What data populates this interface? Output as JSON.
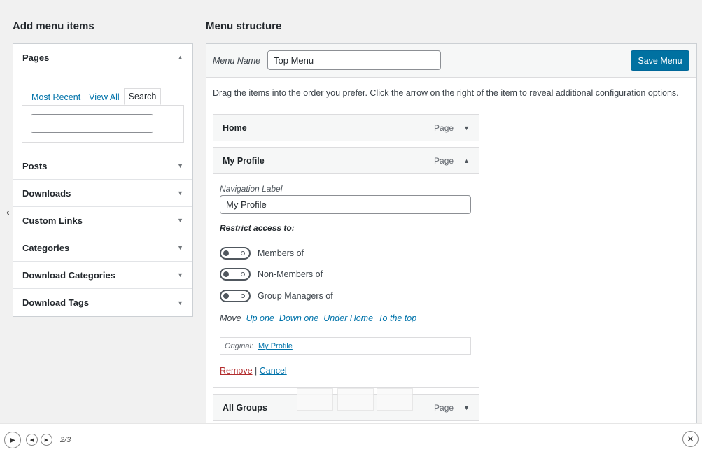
{
  "left_heading": "Add menu items",
  "right_heading": "Menu structure",
  "pages_panel": {
    "title": "Pages",
    "tabs": [
      "Most Recent",
      "View All",
      "Search"
    ],
    "active_tab": "Search",
    "search_value": ""
  },
  "accordion": [
    {
      "label": "Posts"
    },
    {
      "label": "Downloads"
    },
    {
      "label": "Custom Links"
    },
    {
      "label": "Categories"
    },
    {
      "label": "Download Categories"
    },
    {
      "label": "Download Tags"
    }
  ],
  "menu": {
    "name_label": "Menu Name",
    "name_value": "Top Menu",
    "save_label": "Save Menu",
    "instructions": "Drag the items into the order you prefer. Click the arrow on the right of the item to reveal additional configuration options."
  },
  "items": [
    {
      "title": "Home",
      "type": "Page"
    },
    {
      "title": "My Profile",
      "type": "Page"
    },
    {
      "title": "All Groups",
      "type": "Page"
    }
  ],
  "settings": {
    "nav_label": "Navigation Label",
    "nav_value": "My Profile",
    "restrict_label": "Restrict access to:",
    "toggles": [
      {
        "label": "Members of",
        "on": false
      },
      {
        "label": "Non-Members of",
        "on": false
      },
      {
        "label": "Group Managers of",
        "on": false
      }
    ],
    "move_label": "Move",
    "move_links": [
      "Up one",
      "Down one",
      "Under Home",
      "To the top"
    ],
    "original_label": "Original:",
    "original_link": "My Profile",
    "remove_label": "Remove",
    "separator": "|",
    "cancel_label": "Cancel"
  },
  "player": {
    "counter": "2/3"
  },
  "colors": {
    "accent": "#0071a1",
    "link": "#0073aa",
    "remove": "#b32d2e"
  }
}
